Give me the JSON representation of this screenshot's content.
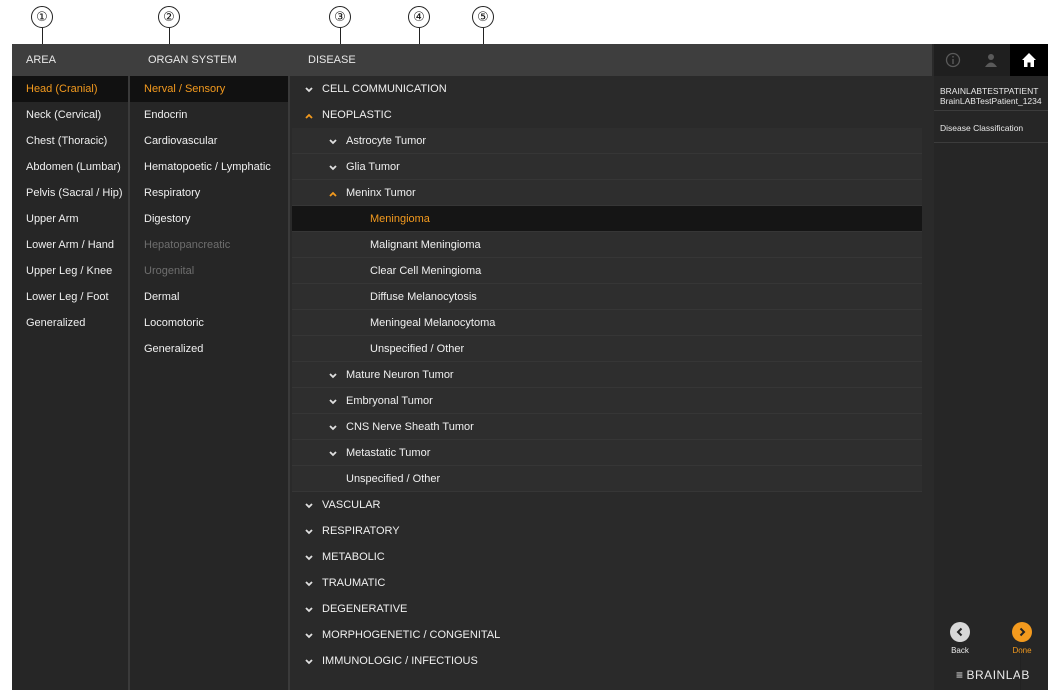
{
  "callouts": [
    "①",
    "②",
    "③",
    "④",
    "⑤"
  ],
  "headers": {
    "area": "AREA",
    "organ": "ORGAN SYSTEM",
    "disease": "DISEASE"
  },
  "area_items": [
    {
      "label": "Head (Cranial)",
      "state": "selected"
    },
    {
      "label": "Neck (Cervical)",
      "state": "normal"
    },
    {
      "label": "Chest (Thoracic)",
      "state": "normal"
    },
    {
      "label": "Abdomen (Lumbar)",
      "state": "normal"
    },
    {
      "label": "Pelvis (Sacral / Hip)",
      "state": "normal"
    },
    {
      "label": "Upper Arm",
      "state": "normal"
    },
    {
      "label": "Lower Arm / Hand",
      "state": "normal"
    },
    {
      "label": "Upper Leg / Knee",
      "state": "normal"
    },
    {
      "label": "Lower Leg / Foot",
      "state": "normal"
    },
    {
      "label": "Generalized",
      "state": "normal"
    }
  ],
  "organ_items": [
    {
      "label": "Nerval / Sensory",
      "state": "selected"
    },
    {
      "label": "Endocrin",
      "state": "normal"
    },
    {
      "label": "Cardiovascular",
      "state": "normal"
    },
    {
      "label": "Hematopoetic / Lymphatic",
      "state": "normal"
    },
    {
      "label": "Respiratory",
      "state": "normal"
    },
    {
      "label": "Digestory",
      "state": "normal"
    },
    {
      "label": "Hepatopancreatic",
      "state": "disabled"
    },
    {
      "label": "Urogenital",
      "state": "disabled"
    },
    {
      "label": "Dermal",
      "state": "normal"
    },
    {
      "label": "Locomotoric",
      "state": "normal"
    },
    {
      "label": "Generalized",
      "state": "normal"
    }
  ],
  "disease_rows": [
    {
      "label": "CELL COMMUNICATION",
      "level": 0,
      "arrow": "down"
    },
    {
      "label": "NEOPLASTIC",
      "level": 0,
      "arrow": "up"
    },
    {
      "label": "Astrocyte Tumor",
      "level": 1,
      "arrow": "down"
    },
    {
      "label": "Glia Tumor",
      "level": 1,
      "arrow": "down"
    },
    {
      "label": "Meninx Tumor",
      "level": 1,
      "arrow": "up"
    },
    {
      "label": "Meningioma",
      "level": 2,
      "arrow": "none",
      "state": "selected"
    },
    {
      "label": "Malignant Meningioma",
      "level": 2,
      "arrow": "none"
    },
    {
      "label": "Clear Cell Meningioma",
      "level": 2,
      "arrow": "none"
    },
    {
      "label": "Diffuse Melanocytosis",
      "level": 2,
      "arrow": "none"
    },
    {
      "label": "Meningeal Melanocytoma",
      "level": 2,
      "arrow": "none"
    },
    {
      "label": "Unspecified / Other",
      "level": 2,
      "arrow": "none"
    },
    {
      "label": "Mature Neuron Tumor",
      "level": 1,
      "arrow": "down"
    },
    {
      "label": "Embryonal Tumor",
      "level": 1,
      "arrow": "down"
    },
    {
      "label": "CNS Nerve Sheath Tumor",
      "level": 1,
      "arrow": "down"
    },
    {
      "label": "Metastatic Tumor",
      "level": 1,
      "arrow": "down"
    },
    {
      "label": "Unspecified / Other",
      "level": 1,
      "arrow": "none"
    },
    {
      "label": "VASCULAR",
      "level": 0,
      "arrow": "down"
    },
    {
      "label": "RESPIRATORY",
      "level": 0,
      "arrow": "down"
    },
    {
      "label": "METABOLIC",
      "level": 0,
      "arrow": "down"
    },
    {
      "label": "TRAUMATIC",
      "level": 0,
      "arrow": "down"
    },
    {
      "label": "DEGENERATIVE",
      "level": 0,
      "arrow": "down"
    },
    {
      "label": "MORPHOGENETIC / CONGENITAL",
      "level": 0,
      "arrow": "down"
    },
    {
      "label": "IMMUNOLOGIC / INFECTIOUS",
      "level": 0,
      "arrow": "down"
    }
  ],
  "right_panel": {
    "toolbar_icons": [
      "info-icon",
      "patient-icon",
      "home-icon"
    ],
    "patient_name": "BRAINLABTESTPATIENT",
    "patient_id": "BrainLABTestPatient_1234",
    "breadcrumb": "Disease Classification",
    "back_label": "Back",
    "done_label": "Done",
    "brand": "BRAINLAB"
  },
  "colors": {
    "accent": "#f39a1e",
    "background": "#2a2a2a",
    "header": "#3e3e3e",
    "selected_row": "#111111",
    "disabled_text": "#6e6e6e"
  }
}
